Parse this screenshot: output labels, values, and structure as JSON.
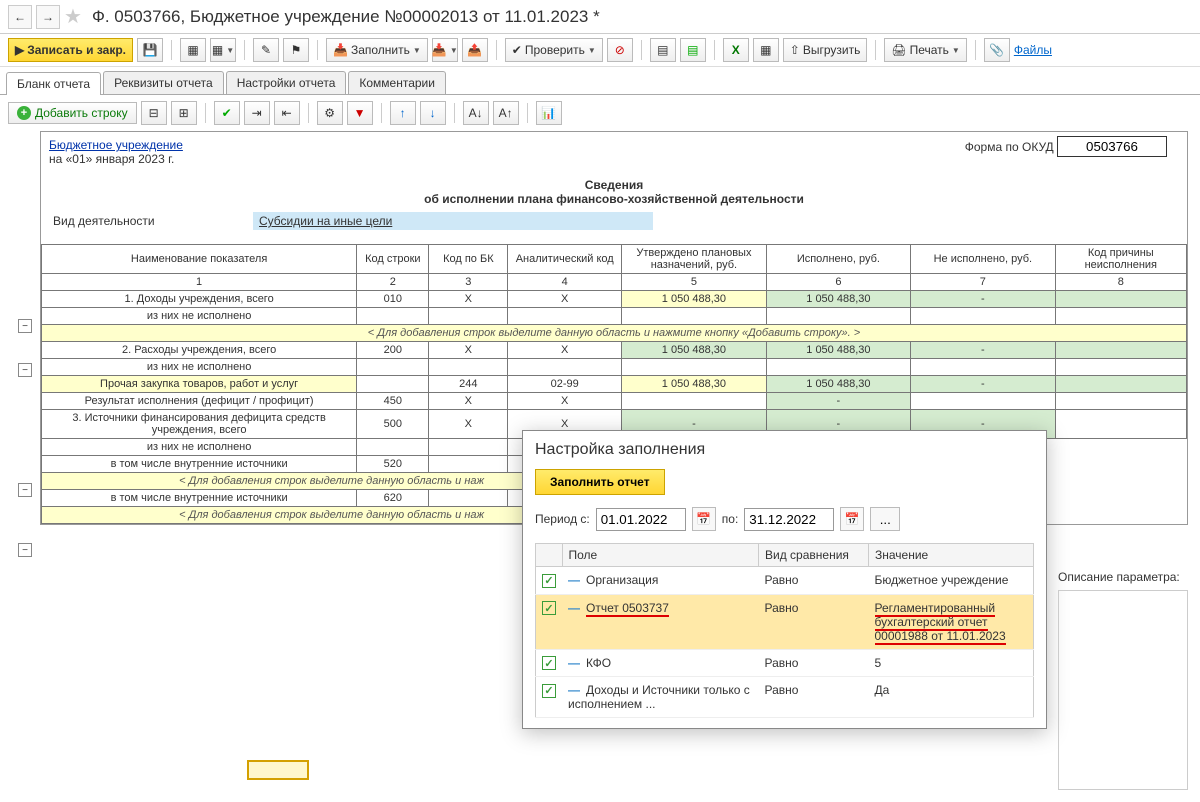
{
  "title": "Ф. 0503766, Бюджетное учреждение №00002013 от 11.01.2023 *",
  "toolbar": {
    "save_close": "Записать и закр.",
    "fill": "Заполнить",
    "check": "Проверить",
    "upload": "Выгрузить",
    "print": "Печать",
    "files": "Файлы"
  },
  "tabs": {
    "blank": "Бланк отчета",
    "requisites": "Реквизиты отчета",
    "settings": "Настройки отчета",
    "comments": "Комментарии"
  },
  "toolbar2": {
    "add_row": "Добавить строку"
  },
  "report": {
    "org": "Бюджетное учреждение",
    "date": "на «01» января 2023 г.",
    "okud_label": "Форма по ОКУД",
    "okud": "0503766",
    "title1": "Сведения",
    "title2": "об исполнении плана финансово-хозяйственной деятельности",
    "activity_label": "Вид деятельности",
    "activity_value": "Субсидии на иные цели"
  },
  "headers": {
    "h1": "Наименование показателя",
    "h2": "Код строки",
    "h3": "Код по БК",
    "h4": "Аналитический код",
    "h5": "Утверждено плановых назначений, руб.",
    "h6": "Исполнено, руб.",
    "h7": "Не исполнено, руб.",
    "h8": "Код причины неисполнения"
  },
  "nums": {
    "c1": "1",
    "c2": "2",
    "c3": "3",
    "c4": "4",
    "c5": "5",
    "c6": "6",
    "c7": "7",
    "c8": "8"
  },
  "rows": {
    "r1": {
      "name": "1. Доходы учреждения, всего",
      "code": "010",
      "bk": "X",
      "an": "X",
      "plan": "1 050 488,30",
      "done": "1 050 488,30",
      "not": "-",
      "reason": ""
    },
    "r1a": {
      "name": "из них не исполнено"
    },
    "hint": "< Для добавления строк выделите данную область и нажмите кнопку «Добавить строку». >",
    "r2": {
      "name": "2. Расходы учреждения, всего",
      "code": "200",
      "bk": "X",
      "an": "X",
      "plan": "1 050 488,30",
      "done": "1 050 488,30",
      "not": "-",
      "reason": ""
    },
    "r2a": {
      "name": "из них не исполнено"
    },
    "r2b": {
      "name": "Прочая закупка товаров, работ и услуг",
      "code": "",
      "bk": "244",
      "an": "02-99",
      "plan": "1 050 488,30",
      "done": "1 050 488,30",
      "not": "-",
      "reason": ""
    },
    "r3": {
      "name": "Результат исполнения (дефицит / профицит)",
      "code": "450",
      "bk": "X",
      "an": "X",
      "plan": "",
      "done": "-",
      "not": "",
      "reason": ""
    },
    "r4": {
      "name": "3. Источники финансирования дефицита средств учреждения, всего",
      "code": "500",
      "bk": "X",
      "an": "X",
      "plan": "-",
      "done": "-",
      "not": "-",
      "reason": ""
    },
    "r4a": {
      "name": "из них не исполнено"
    },
    "r4b": {
      "name": "в том числе внутренние источники",
      "code": "520"
    },
    "hint2": "< Для добавления строк выделите данную область и наж",
    "r4c": {
      "name": "в том числе внутренние источники",
      "code": "620"
    },
    "hint3": "< Для добавления строк выделите данную область и наж"
  },
  "panel": {
    "title": "Настройка заполнения",
    "fill_btn": "Заполнить отчет",
    "period_from_label": "Период с:",
    "period_from": "01.01.2022",
    "period_to_label": "по:",
    "period_to": "31.12.2022",
    "cols": {
      "field": "Поле",
      "cmp": "Вид сравнения",
      "val": "Значение"
    },
    "p1": {
      "field": "Организация",
      "cmp": "Равно",
      "val": "Бюджетное учреждение"
    },
    "p2": {
      "field": "Отчет 0503737",
      "cmp": "Равно",
      "val": "Регламентированный бухгалтерский отчет 00001988 от 11.01.2023"
    },
    "p3": {
      "field": "КФО",
      "cmp": "Равно",
      "val": "5"
    },
    "p4": {
      "field": "Доходы и Источники только с исполнением ...",
      "cmp": "Равно",
      "val": "Да"
    }
  },
  "side": {
    "label": "Описание параметра:"
  }
}
